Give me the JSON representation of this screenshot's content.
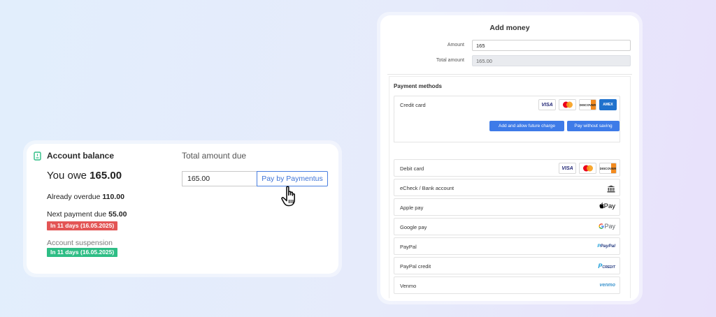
{
  "account": {
    "title": "Account balance",
    "owe_prefix": "You owe",
    "owe_amount": "165.00",
    "overdue_label": "Already overdue",
    "overdue_amount": "110.00",
    "next_label": "Next payment due",
    "next_amount": "55.00",
    "next_badge": "In 11 days (16.05.2025)",
    "suspension_label": "Account suspension",
    "suspension_badge": "In 11 days (16.05.2025)",
    "total_label": "Total amount due",
    "amount_value": "165.00",
    "pay_button": "Pay by Paymentus"
  },
  "add_money": {
    "title": "Add money",
    "amount_label": "Amount",
    "amount_value": "165",
    "total_label": "Total amount",
    "total_value": "165.00",
    "methods_title": "Payment methods",
    "credit_card": {
      "label": "Credit card",
      "logos": [
        "VISA",
        "mastercard",
        "DISCOVER",
        "AMEX"
      ],
      "button_allow": "Add and allow future charge",
      "button_once": "Pay without saving"
    },
    "methods": [
      {
        "label": "Debit card",
        "logos": [
          "VISA",
          "mastercard",
          "DISCOVER"
        ]
      },
      {
        "label": "eCheck / Bank account",
        "icon": "bank-icon"
      },
      {
        "label": "Apple pay",
        "logo_text": "Pay"
      },
      {
        "label": "Google pay",
        "logo_text": "Pay"
      },
      {
        "label": "PayPal",
        "logo_text": "PayPal"
      },
      {
        "label": "PayPal credit",
        "logo_text": "CREDIT"
      },
      {
        "label": "Venmo",
        "logo_text": "venmo"
      }
    ]
  },
  "colors": {
    "accent": "#3e7be8",
    "danger_badge": "#e35555",
    "success_badge": "#2ebd85"
  }
}
